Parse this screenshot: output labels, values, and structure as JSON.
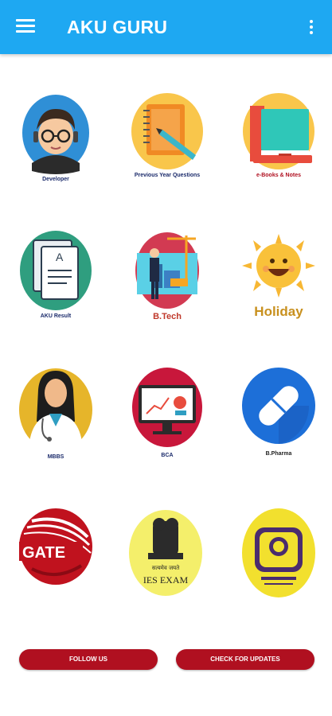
{
  "app": {
    "title": "AKU GURU"
  },
  "icons": {
    "menu": "hamburger-menu-icon",
    "more": "more-vert-icon"
  },
  "colors": {
    "appbar": "#1ea8f2",
    "button": "#b01020"
  },
  "tiles": [
    {
      "label": "Developer"
    },
    {
      "label": "Previous Year Questions"
    },
    {
      "label": "e-Books & Notes"
    },
    {
      "label": "AKU Result"
    },
    {
      "label": "B.Tech"
    },
    {
      "label": "Holiday"
    },
    {
      "label": "MBBS"
    },
    {
      "label": "BCA"
    },
    {
      "label": "B.Pharma"
    },
    {
      "label": "GATE"
    },
    {
      "label": "IES EXAM"
    },
    {
      "label": ""
    }
  ],
  "art_text": {
    "doc_letter": "A",
    "hindi_motto": "सत्यमेव जयते"
  },
  "buttons": {
    "follow": "FOLLOW US",
    "updates": "CHECK FOR UPDATES"
  }
}
